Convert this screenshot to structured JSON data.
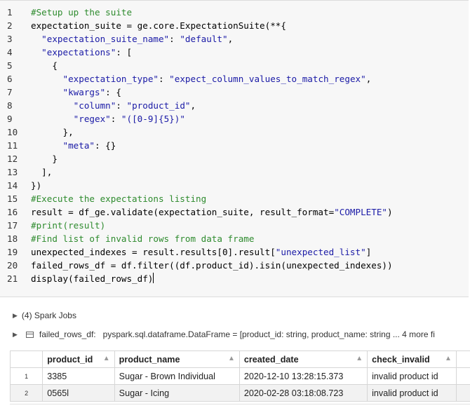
{
  "code_lines": [
    {
      "num": "1",
      "text": "#Setup up the suite"
    },
    {
      "num": "2",
      "text": "expectation_suite = ge.core.ExpectationSuite(**{"
    },
    {
      "num": "3",
      "text": "  \"expectation_suite_name\": \"default\","
    },
    {
      "num": "4",
      "text": "  \"expectations\": ["
    },
    {
      "num": "5",
      "text": "    {"
    },
    {
      "num": "6",
      "text": "      \"expectation_type\": \"expect_column_values_to_match_regex\","
    },
    {
      "num": "7",
      "text": "      \"kwargs\": {"
    },
    {
      "num": "8",
      "text": "        \"column\": \"product_id\","
    },
    {
      "num": "9",
      "text": "        \"regex\": \"([0-9]{5})\""
    },
    {
      "num": "10",
      "text": "      },"
    },
    {
      "num": "11",
      "text": "      \"meta\": {}"
    },
    {
      "num": "12",
      "text": "    }"
    },
    {
      "num": "13",
      "text": "  ],"
    },
    {
      "num": "14",
      "text": "})"
    },
    {
      "num": "15",
      "text": "#Execute the expectations listing"
    },
    {
      "num": "16",
      "text": "result = df_ge.validate(expectation_suite, result_format=\"COMPLETE\")"
    },
    {
      "num": "17",
      "text": "#print(result)"
    },
    {
      "num": "18",
      "text": "#Find list of invalid rows from data frame"
    },
    {
      "num": "19",
      "text": "unexpected_indexes = result.results[0].result[\"unexpected_list\"]"
    },
    {
      "num": "20",
      "text": "failed_rows_df = df.filter((df.product_id).isin(unexpected_indexes))"
    },
    {
      "num": "21",
      "text": "display(failed_rows_df)"
    }
  ],
  "spark_jobs": {
    "label": "(4) Spark Jobs"
  },
  "dataframe_info": {
    "name": "failed_rows_df:",
    "schema": "pyspark.sql.dataframe.DataFrame = [product_id: string, product_name: string ... 4 more fi"
  },
  "table": {
    "headers": [
      "product_id",
      "product_name",
      "created_date",
      "check_invalid"
    ],
    "rows": [
      {
        "index": "1",
        "cells": [
          "3385",
          "Sugar - Brown Individual",
          "2020-12-10 13:28:15.373",
          "invalid product id"
        ]
      },
      {
        "index": "2",
        "cells": [
          "0565l",
          "Sugar - Icing",
          "2020-02-28 03:18:08.723",
          "invalid product id"
        ]
      }
    ]
  },
  "colors": {
    "comment": "#2e8b2e",
    "string": "#1a1aa6",
    "cell_bg": "#f7f7f7"
  },
  "icons": {
    "sort": "sort-triangle-icon",
    "expand": "expand-triangle-icon",
    "table": "table-icon"
  }
}
